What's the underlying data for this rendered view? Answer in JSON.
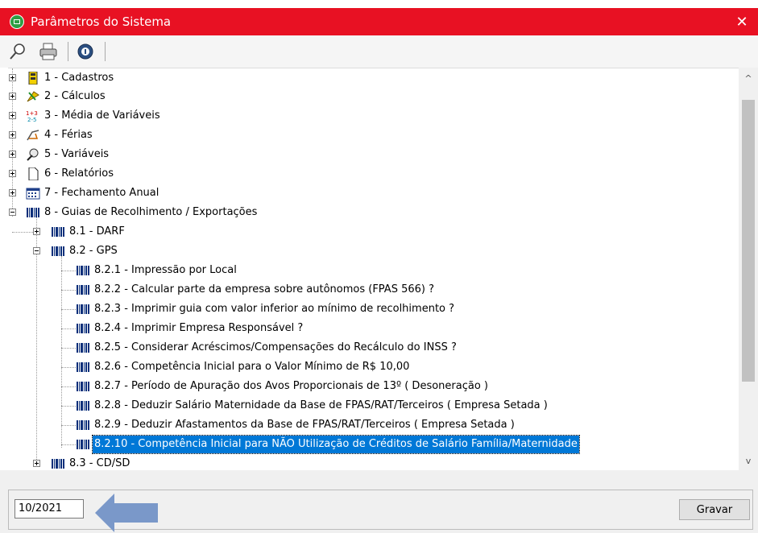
{
  "window": {
    "title": "Parâmetros do Sistema",
    "close_glyph": "✕",
    "accent": "#e81123"
  },
  "toolbar": {
    "buttons": [
      {
        "icon": "search-icon"
      },
      {
        "icon": "printer-icon"
      },
      {
        "icon": "info-icon"
      }
    ]
  },
  "tree": {
    "items": [
      {
        "label": "1 - Cadastros",
        "expanded": false
      },
      {
        "label": "2 - Cálculos",
        "expanded": false
      },
      {
        "label": "3 - Média de Variáveis",
        "expanded": false
      },
      {
        "label": "4 - Férias",
        "expanded": false
      },
      {
        "label": "5 - Variáveis",
        "expanded": false
      },
      {
        "label": "6 - Relatórios",
        "expanded": false
      },
      {
        "label": "7 - Fechamento Anual",
        "expanded": false
      },
      {
        "label": "8 - Guias de Recolhimento / Exportações",
        "expanded": true
      },
      {
        "label": "8.1 - DARF",
        "expanded": false
      },
      {
        "label": "8.2 - GPS",
        "expanded": true
      },
      {
        "label": "8.2.1  - Impressão por Local"
      },
      {
        "label": "8.2.2  - Calcular parte da empresa sobre autônomos (FPAS 566) ?"
      },
      {
        "label": "8.2.3  - Imprimir guia com valor inferior ao mínimo de recolhimento ?"
      },
      {
        "label": "8.2.4  - Imprimir Empresa Responsável ?"
      },
      {
        "label": "8.2.5  - Considerar Acréscimos/Compensações do Recálculo do INSS ?"
      },
      {
        "label": "8.2.6  - Competência Inicial para o Valor Mínimo de R$ 10,00"
      },
      {
        "label": "8.2.7  - Período de Apuração dos Avos Proporcionais de 13º ( Desoneração )"
      },
      {
        "label": "8.2.8  - Deduzir Salário Maternidade da Base de FPAS/RAT/Terceiros ( Empresa Setada )"
      },
      {
        "label": "8.2.9  - Deduzir Afastamentos da Base de FPAS/RAT/Terceiros ( Empresa Setada )"
      },
      {
        "label": "8.2.10 - Competência Inicial para NÃO Utilização de Créditos de Salário Família/Maternidade",
        "selected": true
      },
      {
        "label": "8.3 - CD/SD",
        "expanded": false
      }
    ]
  },
  "scrollbar": {
    "up": "^",
    "down": "v"
  },
  "footer": {
    "value": "10/2021",
    "save_label": "Gravar"
  }
}
